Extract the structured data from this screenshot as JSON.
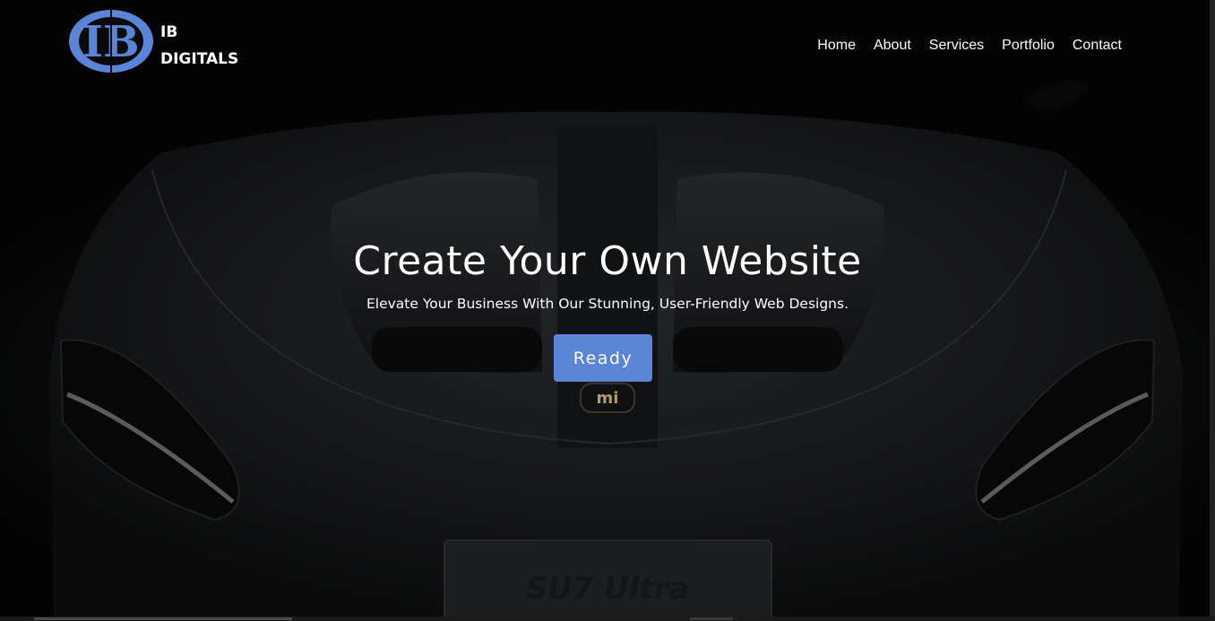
{
  "brand": {
    "line1": "IB",
    "line2": "DIGITALS",
    "logo_letters": "IB"
  },
  "nav": {
    "items": [
      {
        "label": "Home"
      },
      {
        "label": "About"
      },
      {
        "label": "Services"
      },
      {
        "label": "Portfolio"
      },
      {
        "label": "Contact"
      }
    ]
  },
  "hero": {
    "title": "Create Your Own Website",
    "subtitle": "Elevate Your Business With Our Stunning, User-Friendly Web Designs.",
    "cta_label": "Ready",
    "car_badge": "mi",
    "plate_text": "SU7 Ultra"
  },
  "colors": {
    "accent": "#5a85d6",
    "logo_blue": "#5a85d6",
    "background": "#0a0a0a"
  },
  "icons": {
    "logo": "ib-monogram-icon"
  }
}
